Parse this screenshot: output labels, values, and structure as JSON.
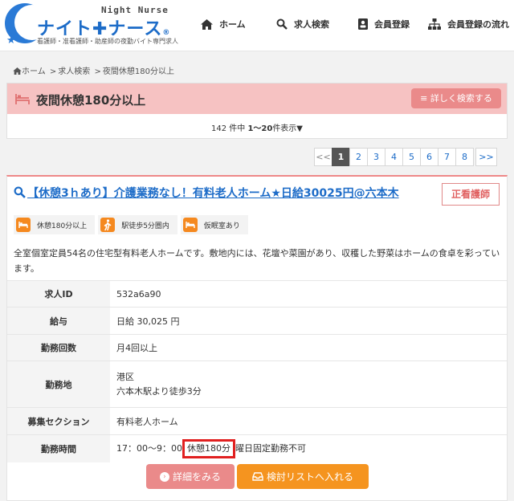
{
  "header": {
    "logo_night": "Night Nurse",
    "logo_name": "ナイト✚ナース",
    "logo_reg": "®",
    "logo_tagline": "看護師・准看護師・助産師の夜勤バイト専門求人",
    "nav": [
      {
        "label": "ホーム",
        "icon": "home-icon"
      },
      {
        "label": "求人検索",
        "icon": "search-icon"
      },
      {
        "label": "会員登録",
        "icon": "member-card-icon"
      },
      {
        "label": "会員登録の流れ",
        "icon": "sitemap-icon"
      }
    ]
  },
  "breadcrumb": {
    "home": "ホーム",
    "sep": ">",
    "search": "求人検索",
    "current": "夜間休憩180分以上"
  },
  "search_header": {
    "title": "夜間休憩180分以上",
    "detail_button": "≡ 詳しく検索する",
    "count_prefix": "142 件中 ",
    "count_range": "1〜20",
    "count_suffix": "件表示▼"
  },
  "pagination": {
    "prev": "<<",
    "pages": [
      "1",
      "2",
      "3",
      "4",
      "5",
      "6",
      "7",
      "8"
    ],
    "active": "1",
    "next": ">>"
  },
  "job": {
    "title": "【休憩3ｈあり】介護業務なし！有料老人ホーム★日給30025円@六本木",
    "type": "正看護師",
    "tags": [
      {
        "label": "休憩180分以上",
        "icon": "bed-icon"
      },
      {
        "label": "駅徒歩5分圏内",
        "icon": "walking-icon"
      },
      {
        "label": "仮眠室あり",
        "icon": "bed-icon"
      }
    ],
    "description": "全室個室定員54名の住宅型有料老人ホームです。敷地内には、花壇や菜園があり、収穫した野菜はホームの食卓を彩っています。",
    "rows": {
      "id_label": "求人ID",
      "id_value": "532a6a90",
      "pay_label": "給与",
      "pay_value": "日給 30,025 円",
      "count_label": "勤務回数",
      "count_value": "月4回以上",
      "place_label": "勤務地",
      "place_value_1": "港区",
      "place_value_2": "六本木駅より徒歩3分",
      "section_label": "募集セクション",
      "section_value": "有料老人ホーム",
      "time_label": "勤務時間",
      "time_value": "17：00〜9：00",
      "time_break": "休憩180分",
      "time_note": "曜日固定勤務不可"
    },
    "detail_button": "詳細をみる",
    "list_button": "検討リストへ入れる"
  },
  "colors": {
    "brand_blue": "#1d6cc8",
    "pink": "#ea8a8a",
    "orange": "#f5941f",
    "highlight_red": "#e12020"
  }
}
